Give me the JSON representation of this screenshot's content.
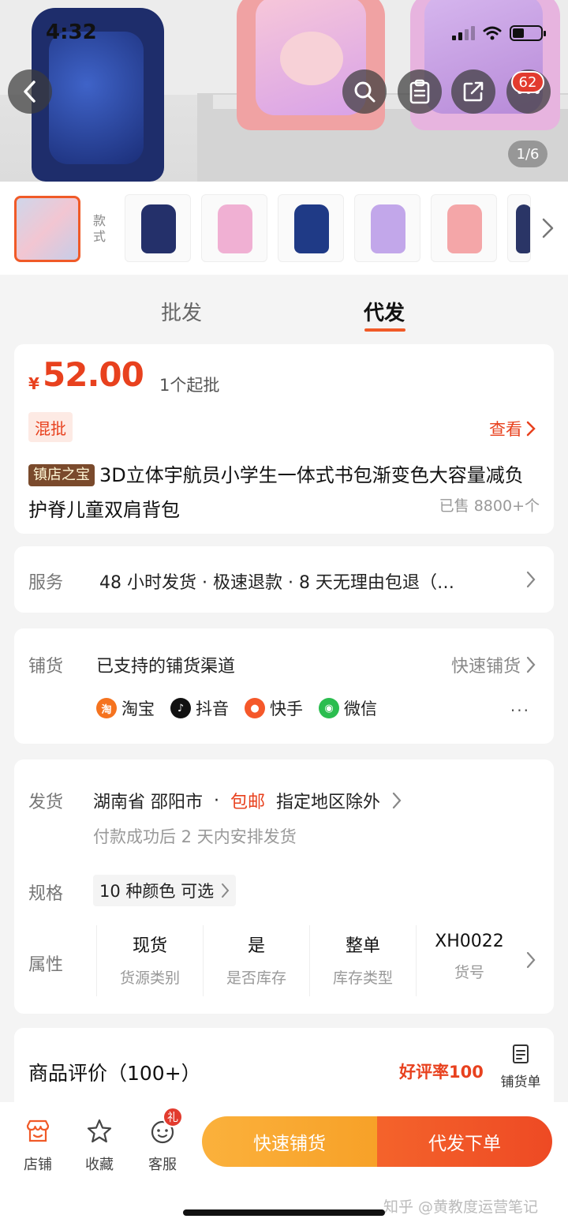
{
  "status_bar": {
    "time": "4:32"
  },
  "gallery": {
    "cart_badge": "62",
    "page_indicator": "1/6"
  },
  "variants": {
    "label": "款式"
  },
  "tabs": [
    {
      "label": "批发"
    },
    {
      "label": "代发"
    }
  ],
  "product": {
    "currency": "¥",
    "price": "52.00",
    "moq": "1个起批",
    "mixed_tag": "混批",
    "view_label": "查看",
    "store_tag": "镇店之宝",
    "title": "3D立体宇航员小学生一体式书包渐变色大容量减负护脊儿童双肩背包",
    "sold": "已售 8800+个"
  },
  "service": {
    "label": "服务",
    "text": "48 小时发货 · 极速退款 · 8 天无理由包退（…"
  },
  "distribution": {
    "label": "铺货",
    "heading": "已支持的铺货渠道",
    "quick_label": "快速铺货",
    "channels": [
      {
        "name": "淘宝",
        "icon": "taobao-icon",
        "color": "#f5731f"
      },
      {
        "name": "抖音",
        "icon": "douyin-icon",
        "color": "#111111"
      },
      {
        "name": "快手",
        "icon": "kuaishou-icon",
        "color": "#f5582a"
      },
      {
        "name": "微信",
        "icon": "wechat-icon",
        "color": "#2bbd4f"
      }
    ],
    "more": "···"
  },
  "shipping": {
    "label": "发货",
    "origin": "湖南省 邵阳市",
    "dot": "·",
    "free": "包邮",
    "exclusion": "指定地区除外",
    "note": "付款成功后 2 天内安排发货"
  },
  "spec": {
    "label": "规格",
    "value": "10 种颜色 可选"
  },
  "attributes": {
    "label": "属性",
    "items": [
      {
        "value": "现货",
        "key": "货源类别"
      },
      {
        "value": "是",
        "key": "是否库存"
      },
      {
        "value": "整单",
        "key": "库存类型"
      },
      {
        "value": "XH0022",
        "key": "货号"
      }
    ]
  },
  "reviews": {
    "title": "商品评价（100+）",
    "rate": "好评率100"
  },
  "floating": {
    "list_label": "铺货单"
  },
  "bottom_bar": {
    "store": "店铺",
    "favorite": "收藏",
    "service": "客服",
    "gift_badge": "礼",
    "quick_button": "快速铺货",
    "order_button": "代发下单"
  },
  "watermark": "知乎 @黄教度运营笔记",
  "colors": {
    "accent": "#e8411e",
    "tab_accent": "#f05a28",
    "quick": "#f7a128",
    "order": "#ee4a24"
  }
}
